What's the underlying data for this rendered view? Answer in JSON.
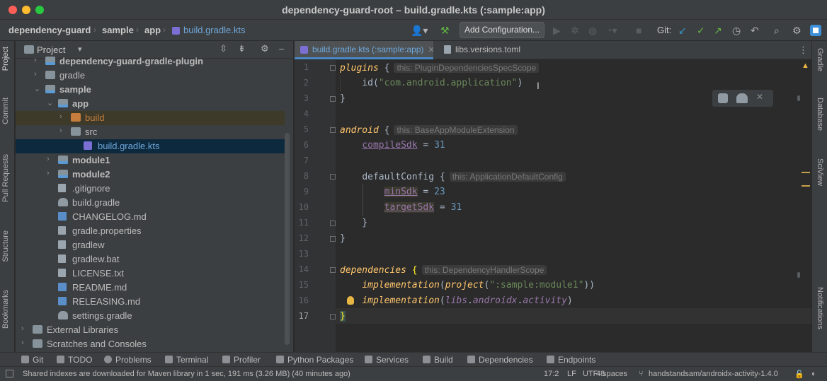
{
  "window": {
    "title": "dependency-guard-root – build.gradle.kts (:sample:app)"
  },
  "breadcrumbs": [
    "dependency-guard",
    "sample",
    "app",
    "build.gradle.kts"
  ],
  "toolbar": {
    "add_configuration_label": "Add Configuration...",
    "git_label": "Git:",
    "icons": [
      "user-icon",
      "hammer-icon",
      "run-icon",
      "debug-icon",
      "profile-icon",
      "coverage-icon",
      "stop-icon",
      "git-update-icon",
      "git-commit-icon",
      "git-push-icon",
      "history-icon",
      "rollback-icon",
      "search-icon",
      "settings-icon",
      "jetbrains-icon"
    ]
  },
  "left_strip": [
    "Project",
    "Commit",
    "Pull Requests",
    "Structure",
    "Bookmarks"
  ],
  "right_strip": [
    "Gradle",
    "Database",
    "SciView",
    "Notifications"
  ],
  "project_panel": {
    "title": "Project",
    "items": [
      {
        "label": "dependency-guard-gradle-plugin",
        "type": "module",
        "depth": 1,
        "bold": true,
        "arrow": "›"
      },
      {
        "label": "gradle",
        "type": "folder",
        "depth": 1,
        "arrow": "›"
      },
      {
        "label": "sample",
        "type": "module",
        "depth": 1,
        "bold": true,
        "arrow": "⌄"
      },
      {
        "label": "app",
        "type": "module",
        "depth": 2,
        "bold": true,
        "arrow": "⌄"
      },
      {
        "label": "build",
        "type": "build",
        "depth": 3,
        "arrow": "›"
      },
      {
        "label": "src",
        "type": "folder",
        "depth": 3,
        "arrow": "›"
      },
      {
        "label": "build.gradle.kts",
        "type": "kts",
        "depth": 4,
        "selected": true
      },
      {
        "label": "module1",
        "type": "module",
        "depth": 2,
        "bold": true,
        "arrow": "›"
      },
      {
        "label": "module2",
        "type": "module",
        "depth": 2,
        "bold": true,
        "arrow": "›"
      },
      {
        "label": ".gitignore",
        "type": "file",
        "depth": 2
      },
      {
        "label": "build.gradle",
        "type": "gradle",
        "depth": 2
      },
      {
        "label": "CHANGELOG.md",
        "type": "md",
        "depth": 2
      },
      {
        "label": "gradle.properties",
        "type": "file",
        "depth": 2
      },
      {
        "label": "gradlew",
        "type": "file",
        "depth": 2
      },
      {
        "label": "gradlew.bat",
        "type": "file",
        "depth": 2
      },
      {
        "label": "LICENSE.txt",
        "type": "file",
        "depth": 2
      },
      {
        "label": "README.md",
        "type": "md",
        "depth": 2
      },
      {
        "label": "RELEASING.md",
        "type": "md",
        "depth": 2
      },
      {
        "label": "settings.gradle",
        "type": "gradle",
        "depth": 2
      },
      {
        "label": "External Libraries",
        "type": "lib",
        "depth": 0,
        "arrow": "›"
      },
      {
        "label": "Scratches and Consoles",
        "type": "scratch",
        "depth": 0,
        "arrow": "›"
      }
    ]
  },
  "tabs": [
    {
      "label": "build.gradle.kts (:sample:app)",
      "active": true
    },
    {
      "label": "libs.versions.toml",
      "active": false
    }
  ],
  "editor": {
    "line_numbers": [
      "1",
      "2",
      "3",
      "4",
      "5",
      "6",
      "7",
      "8",
      "9",
      "10",
      "11",
      "12",
      "13",
      "14",
      "15",
      "16",
      "17"
    ],
    "current_line": "17",
    "hints": {
      "plugins": "this: PluginDependenciesSpecScope",
      "android": "this: BaseAppModuleExtension",
      "defaultConfig": "this: ApplicationDefaultConfig",
      "dependencies": "this: DependencyHandlerScope"
    },
    "tokens": {
      "plugins": "plugins",
      "id": "id",
      "app_id": "\"com.android.application\"",
      "android": "android",
      "compileSdk": "compileSdk",
      "compileSdk_val": "31",
      "defaultConfig": "defaultConfig",
      "minSdk": "minSdk",
      "minSdk_val": "23",
      "targetSdk": "targetSdk",
      "targetSdk_val": "31",
      "dependencies": "dependencies",
      "implementation": "implementation",
      "project": "project",
      "module_path": "\":sample:module1\"",
      "libs": "libs",
      "androidx": "androidx",
      "activity": "activity"
    }
  },
  "bottom_tabs": [
    "Git",
    "TODO",
    "Problems",
    "Terminal",
    "Profiler",
    "Python Packages",
    "Services",
    "Build",
    "Dependencies",
    "Endpoints"
  ],
  "status": {
    "message": "Shared indexes are downloaded for Maven library in 1 sec, 191 ms (3.26 MB) (40 minutes ago)",
    "position": "17:2",
    "line_sep": "LF",
    "encoding": "UTF-8",
    "indent": "4 spaces",
    "branch": "handstandsam/androidx-activity-1.4.0"
  }
}
